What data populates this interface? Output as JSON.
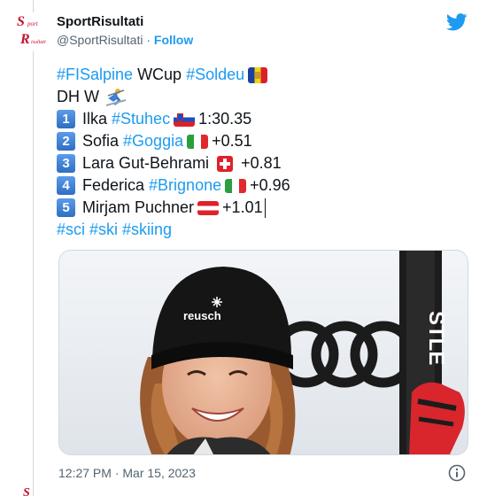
{
  "author": {
    "display_name": "SportRisultati",
    "handle": "@SportRisultati",
    "separator": "·",
    "follow_label": "Follow",
    "avatar_text_top": "Sport",
    "avatar_text_bottom": "Risultati"
  },
  "tweet": {
    "line1": {
      "hashtag1": "#FISalpine",
      "word": "WCup",
      "hashtag2": "#Soldeu"
    },
    "line2": {
      "text": "DH W"
    },
    "results": [
      {
        "rank": "1",
        "first": "Ilka",
        "hashtag": "#Stuhec",
        "flag": "slovenia-flag",
        "result": "1:30.35"
      },
      {
        "rank": "2",
        "first": "Sofia",
        "hashtag": "#Goggia",
        "flag": "italy-flag",
        "result": "+0.51"
      },
      {
        "rank": "3",
        "first": "Lara Gut-Behrami",
        "hashtag": "",
        "flag": "switzerland-flag",
        "result": "+0.81"
      },
      {
        "rank": "4",
        "first": "Federica",
        "hashtag": "#Brignone",
        "flag": "italy-flag",
        "result": "+0.96"
      },
      {
        "rank": "5",
        "first": "Mirjam Puchner",
        "hashtag": "",
        "flag": "austria-flag",
        "result": "+1.01"
      }
    ],
    "tags": [
      "#sci",
      "#ski",
      "#skiing"
    ]
  },
  "photo": {
    "description_icon": "photo-of-smiling-skier",
    "beanie_brand": "reusch",
    "ski_text": "STLE"
  },
  "footer": {
    "timestamp": "12:27 PM · Mar 15, 2023"
  },
  "icons": {
    "bird": "twitter-bird-icon",
    "info": "info-icon"
  },
  "colors": {
    "accent": "#1d9bf0",
    "text": "#0f1419",
    "muted": "#536471"
  }
}
